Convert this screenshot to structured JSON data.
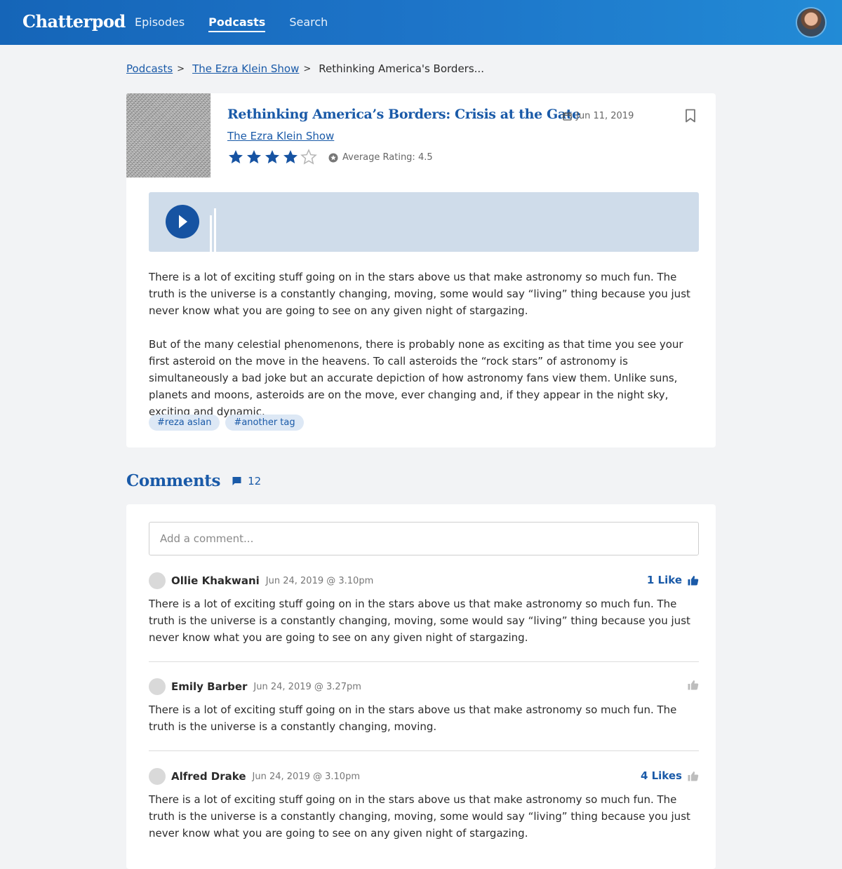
{
  "nav": {
    "brand": "Chatterpod",
    "links": [
      "Episodes",
      "Podcasts",
      "Search"
    ],
    "active": "Podcasts"
  },
  "breadcrumb": {
    "items": [
      "Podcasts",
      "The Ezra Klein Show"
    ],
    "current": "Rethinking America's Borders..."
  },
  "episode": {
    "title": "Rethinking America’s Borders: Crisis at the Gate",
    "date": "Jun 11, 2019",
    "show": "The Ezra Klein Show",
    "rating_stars": 4,
    "rating_max": 5,
    "average_rating_label": "Average Rating: 4.5",
    "description": [
      "There is a lot of exciting stuff going on in the stars above us that make astronomy so much fun. The truth is the universe is a constantly changing, moving, some would say “living” thing because you just never know what you are going to see on any given night of stargazing.",
      "But of the many celestial phenomenons, there is probably none as exciting as that time you see your first asteroid on the move in the heavens. To call asteroids the “rock stars” of astronomy is simultaneously a bad joke but an accurate depiction of how astronomy fans view them. Unlike suns, planets and moons, asteroids are on the move, ever changing and, if they appear in the night sky, exciting and dynamic."
    ],
    "tags": [
      "#reza aslan",
      "#another tag"
    ]
  },
  "comments": {
    "title": "Comments",
    "count": "12",
    "input_placeholder": "Add a comment...",
    "items": [
      {
        "author": "Ollie Khakwani",
        "time": "Jun 24, 2019 @ 3.10pm",
        "likes_label": "1 Like",
        "text": "There is a lot of exciting stuff going on in the stars above us that make astronomy so much fun. The truth is the universe is a constantly changing, moving, some would say “living” thing because you just never know what you are going to see on any given night of stargazing."
      },
      {
        "author": "Emily Barber",
        "time": "Jun 24, 2019 @ 3.27pm",
        "likes_label": "",
        "text": "There is a lot of exciting stuff going on in the stars above us that make astronomy so much fun. The truth is the universe is a constantly changing, moving."
      },
      {
        "author": "Alfred Drake",
        "time": "Jun 24, 2019 @ 3.10pm",
        "likes_label": "4 Likes",
        "text": "There is a lot of exciting stuff going on in the stars above us that make astronomy so much fun. The truth is the universe is a constantly changing, moving, some would say “living” thing because you just never know what you are going to see on any given night of stargazing."
      }
    ]
  },
  "colors": {
    "accent": "#1a5aa8",
    "header_start": "#1565b8",
    "header_end": "#228bd6",
    "player_bg": "#cfdcea",
    "star_filled": "#1653a2",
    "star_empty": "#b5b5b5"
  },
  "icons": [
    "calendar-icon",
    "bookmark-icon",
    "star-icon",
    "badge-icon",
    "play-icon",
    "comment-icon",
    "thumb-up-icon"
  ]
}
